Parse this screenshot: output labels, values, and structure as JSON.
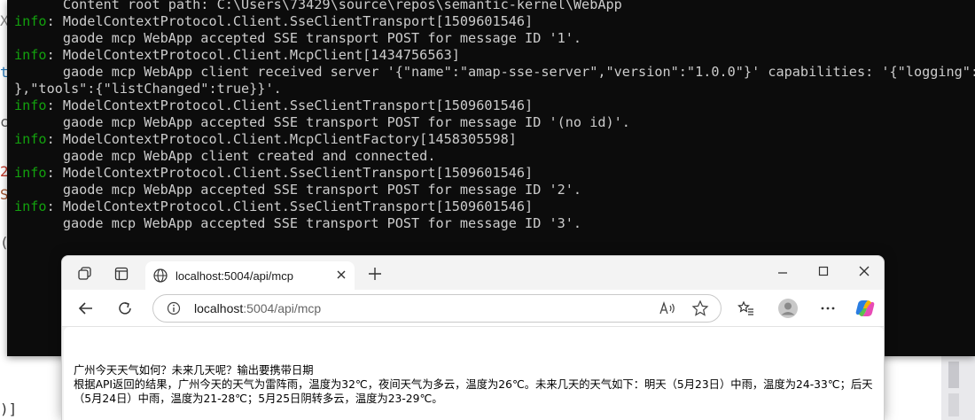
{
  "background": {
    "glyphs": [
      "X",
      "t",
      "c",
      "2",
      "S",
      "(",
      ")]"
    ]
  },
  "terminal": {
    "lines": [
      {
        "prefix": "",
        "text": "      Content root path: C:\\Users\\73429\\source\\repos\\semantic-kernel\\WebApp"
      },
      {
        "prefix": "info",
        "text": ": ModelContextProtocol.Client.SseClientTransport[1509601546]"
      },
      {
        "prefix": "",
        "text": "      gaode mcp WebApp accepted SSE transport POST for message ID '1'."
      },
      {
        "prefix": "info",
        "text": ": ModelContextProtocol.Client.McpClient[1434756563]"
      },
      {
        "prefix": "",
        "text": "      gaode mcp WebApp client received server '{\"name\":\"amap-sse-server\",\"version\":\"1.0.0\"}' capabilities: '{\"logging\":{"
      },
      {
        "prefix": "",
        "text": "},\"tools\":{\"listChanged\":true}}'."
      },
      {
        "prefix": "info",
        "text": ": ModelContextProtocol.Client.SseClientTransport[1509601546]"
      },
      {
        "prefix": "",
        "text": "      gaode mcp WebApp accepted SSE transport POST for message ID '(no id)'."
      },
      {
        "prefix": "info",
        "text": ": ModelContextProtocol.Client.McpClientFactory[1458305598]"
      },
      {
        "prefix": "",
        "text": "      gaode mcp WebApp client created and connected."
      },
      {
        "prefix": "info",
        "text": ": ModelContextProtocol.Client.SseClientTransport[1509601546]"
      },
      {
        "prefix": "",
        "text": "      gaode mcp WebApp accepted SSE transport POST for message ID '2'."
      },
      {
        "prefix": "info",
        "text": ": ModelContextProtocol.Client.SseClientTransport[1509601546]"
      },
      {
        "prefix": "",
        "text": "      gaode mcp WebApp accepted SSE transport POST for message ID '3'."
      }
    ]
  },
  "browser": {
    "tab": {
      "title": "localhost:5004/api/mcp"
    },
    "address": {
      "host": "localhost",
      "path": ":5004/api/mcp"
    },
    "page": {
      "question": "广州今天天气如何？未来几天呢？输出要携带日期",
      "answer": "根据API返回的结果，广州今天的天气为雷阵雨，温度为32℃，夜间天气为多云，温度为26℃。未来几天的天气如下：明天（5月23日）中雨，温度为24-33℃；后天（5月24日）中雨，温度为21-28℃；5月25日阴转多云，温度为23-29℃。"
    }
  },
  "colors": {
    "terminal_bg": "#0c0c0c",
    "terminal_text": "#cccccc",
    "info_green": "#13a10e"
  }
}
